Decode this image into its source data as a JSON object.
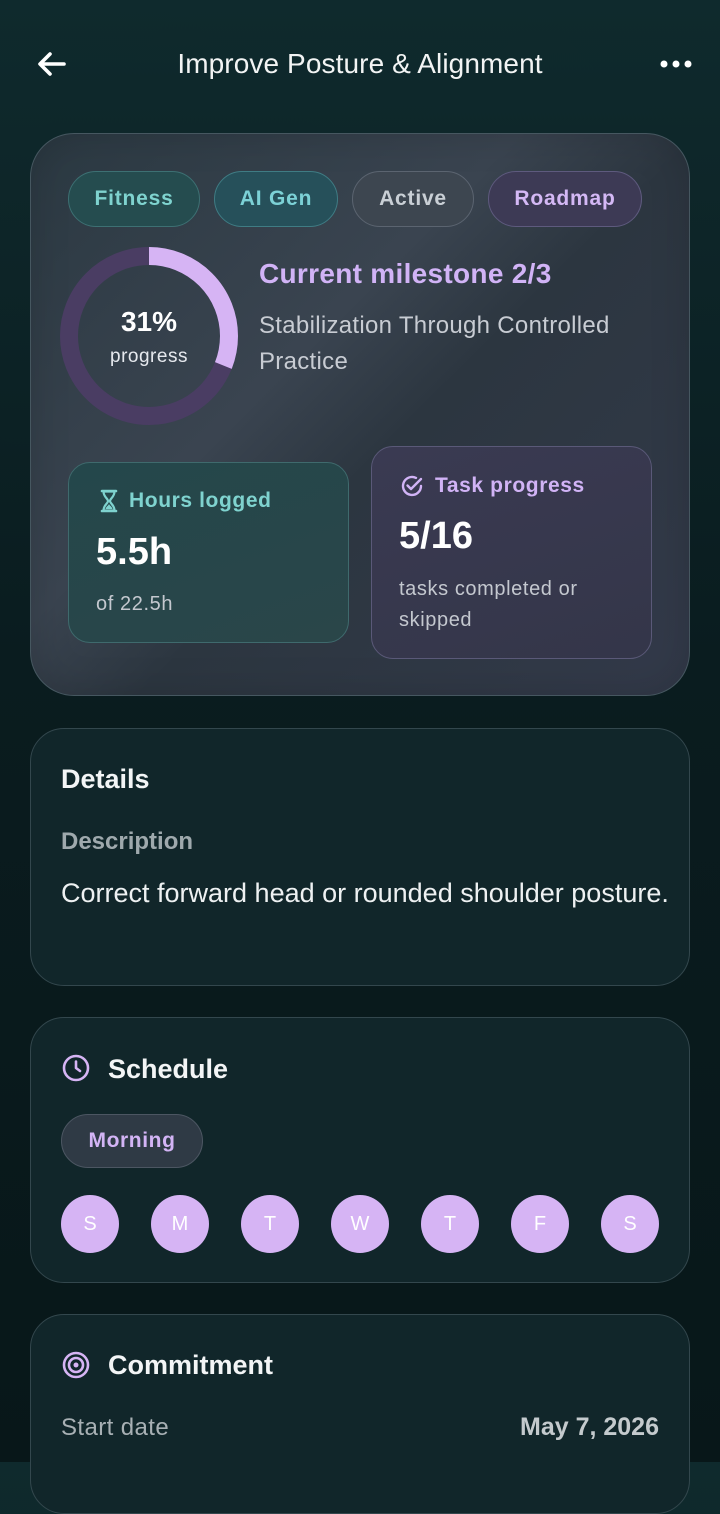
{
  "header": {
    "title": "Improve Posture & Alignment"
  },
  "hero": {
    "tags": [
      "Fitness",
      "AI Gen",
      "Active",
      "Roadmap"
    ],
    "progress": {
      "percent_label": "31%",
      "label": "progress",
      "fraction": 0.31
    },
    "milestone": {
      "title": "Current milestone 2/3",
      "name": "Stabilization Through Controlled Practice"
    },
    "hours": {
      "label": "Hours logged",
      "value": "5.5h",
      "sub": "of 22.5h"
    },
    "tasks": {
      "label": "Task progress",
      "value": "5/16",
      "sub": "tasks completed or skipped"
    }
  },
  "details": {
    "title": "Details",
    "description_label": "Description",
    "description": "Correct forward head or rounded shoulder posture."
  },
  "schedule": {
    "title": "Schedule",
    "time_of_day": "Morning",
    "days": [
      "S",
      "M",
      "T",
      "W",
      "T",
      "F",
      "S"
    ]
  },
  "commitment": {
    "title": "Commitment",
    "start_label": "Start date",
    "start_value": "May 7, 2026"
  },
  "colors": {
    "accent_purple": "#d6b4f4",
    "accent_teal": "#7fd3cf",
    "ring_track": "#4a3d63"
  }
}
